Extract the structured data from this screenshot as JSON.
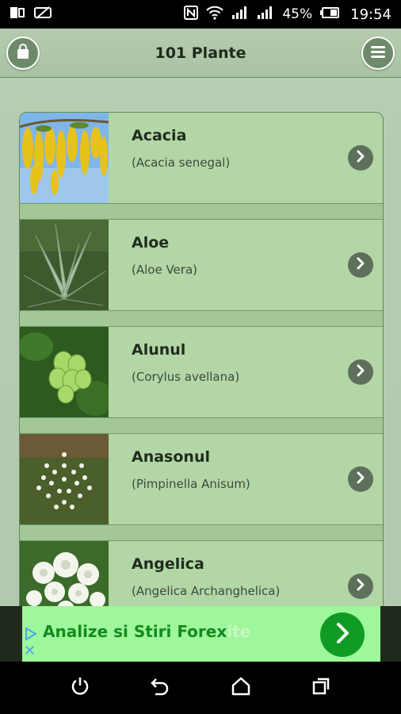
{
  "status_bar": {
    "battery_percent": "45%",
    "time": "19:54",
    "icons": [
      "screen-mirror-icon",
      "no-sim-icon",
      "nfc-icon",
      "wifi-icon",
      "signal-icon",
      "signal-icon",
      "battery-icon"
    ]
  },
  "header": {
    "title": "101 Plante",
    "left_button_icon": "shopping-bag-icon",
    "right_button_icon": "menu-icon",
    "accent": "#6f8a6b"
  },
  "plants": [
    {
      "name": "Acacia",
      "latin": "(Acacia senegal)",
      "image": "acacia-photo"
    },
    {
      "name": "Aloe",
      "latin": "(Aloe Vera)",
      "image": "aloe-photo"
    },
    {
      "name": "Alunul",
      "latin": "(Corylus avellana)",
      "image": "hazelnut-photo"
    },
    {
      "name": "Anasonul",
      "latin": "(Pimpinella Anisum)",
      "image": "anise-photo"
    },
    {
      "name": "Angelica",
      "latin": "(Angelica Archanghelica)",
      "image": "angelica-photo"
    }
  ],
  "ad": {
    "text": "Analize si Stiri Forex",
    "ghost_text": "ite",
    "button_icon": "chevron-right-icon",
    "color": "#148b1c"
  },
  "nav": {
    "icons": [
      "power-icon",
      "back-icon",
      "home-icon",
      "recents-icon"
    ]
  }
}
